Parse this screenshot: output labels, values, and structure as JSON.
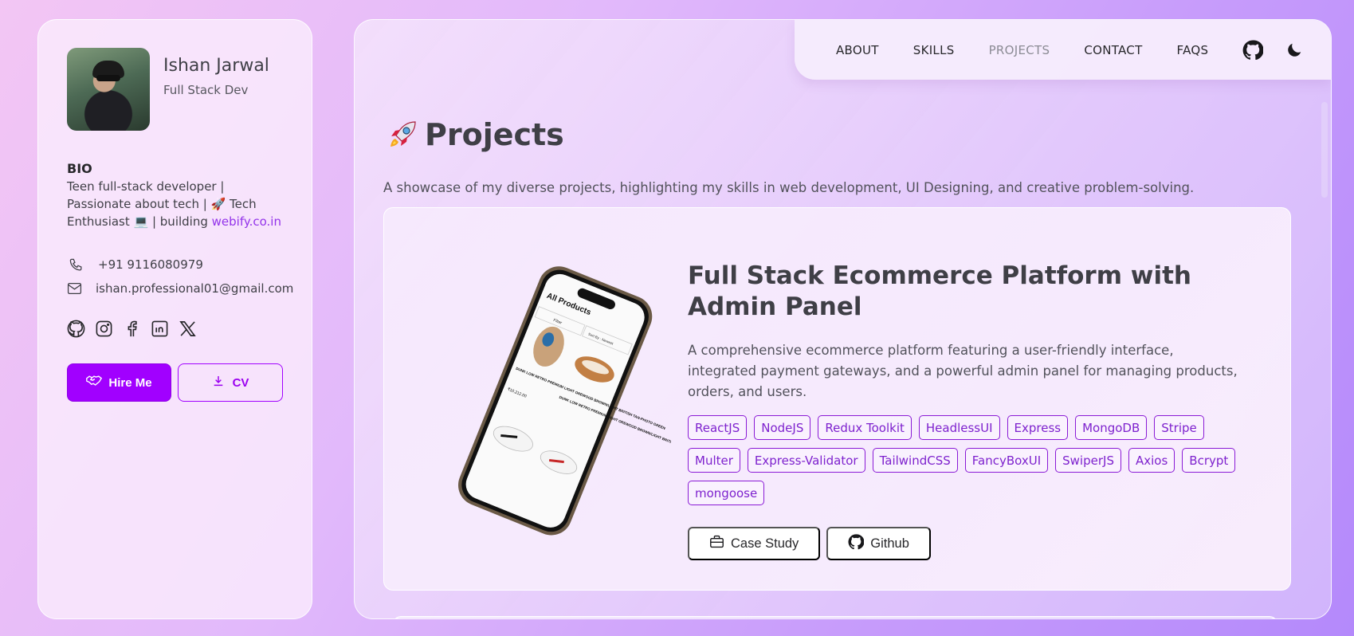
{
  "profile": {
    "name": "Ishan Jarwal",
    "role": "Full Stack Dev",
    "bio_title": "BIO",
    "bio_line1": "Teen full-stack developer |",
    "bio_line2": "Passionate about tech | 🚀 Tech",
    "bio_line3": "Enthusiast 💻 | building ",
    "bio_link": "webify.co.in",
    "phone": "+91 9116080979",
    "email": "ishan.professional01@gmail.com",
    "socials": [
      "github-icon",
      "instagram-icon",
      "facebook-icon",
      "linkedin-icon",
      "x-icon"
    ],
    "hire_label": "Hire Me",
    "cv_label": "CV"
  },
  "nav": {
    "items": [
      "ABOUT",
      "SKILLS",
      "PROJECTS",
      "CONTACT",
      "FAQS"
    ],
    "active": "PROJECTS"
  },
  "page": {
    "title": "Projects",
    "subtitle": "A showcase of my diverse projects, highlighting my skills in web development, UI Designing, and creative problem-solving."
  },
  "project": {
    "title": "Full Stack Ecommerce Platform with Admin Panel",
    "description": "A comprehensive ecommerce platform featuring a user-friendly interface, integrated payment gateways, and a powerful admin panel for managing products, orders, and users.",
    "tags": [
      "ReactJS",
      "NodeJS",
      "Redux Toolkit",
      "HeadlessUI",
      "Express",
      "MongoDB",
      "Stripe",
      "Multer",
      "Express-Validator",
      "TailwindCSS",
      "FancyBoxUI",
      "SwiperJS",
      "Axios",
      "Bcrypt",
      "mongoose"
    ],
    "case_study_label": "Case Study",
    "github_label": "Github",
    "phone_screen": {
      "header": "All Products",
      "filter": "Filter",
      "sort": "Sort By : Newest",
      "item1": "DUNK LOW RETRO PREMIUM LIGHT OREWOOD BROWN/LIGHT BRITISH TAN-PHOTO GREEN",
      "item2": "DUNK LOW RETRO PREMIUM LIGHT OREWOOD BROWN/LIGHT BRITISH TAN-PHOTO WHITE",
      "price": "₹10,212.00"
    }
  },
  "colors": {
    "accent": "#a100ff",
    "tag_border": "#8a1ad6"
  }
}
